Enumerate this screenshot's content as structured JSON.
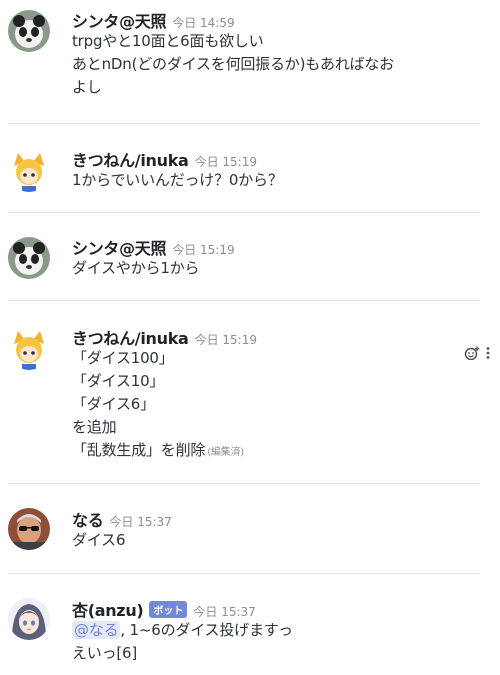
{
  "messages": [
    {
      "author": "シンタ@天照",
      "timestamp": "今日 14:59",
      "avatar": "panda-avatar",
      "lines": [
        "trpgやと10面と6面も欲しい",
        "あとnDn(どのダイスを何回振るか)もあればなお",
        "よし"
      ]
    },
    {
      "author": "きつねん/inuka",
      "timestamp": "今日 15:19",
      "avatar": "fox-girl-avatar",
      "lines": [
        "1からでいいんだっけ？0から？"
      ]
    },
    {
      "author": "シンタ@天照",
      "timestamp": "今日 15:19",
      "avatar": "panda-avatar",
      "lines": [
        "ダイスやから1から"
      ]
    },
    {
      "author": "きつねん/inuka",
      "timestamp": "今日 15:19",
      "avatar": "fox-girl-avatar",
      "lines": [
        "「ダイス100」",
        "「ダイス10」",
        "「ダイス6」",
        "を追加",
        "「乱数生成」を削除"
      ],
      "edited_label": "(編集済)"
    },
    {
      "author": "なる",
      "timestamp": "今日 15:37",
      "avatar": "man-sunglasses-avatar",
      "lines": [
        "ダイス6"
      ]
    },
    {
      "author": "杏(anzu)",
      "timestamp": "今日 15:37",
      "avatar": "anime-girl-avatar",
      "bot_tag": "ボット",
      "mention": "@なる",
      "mention_rest": ", 1~6のダイス投げますっ",
      "lines": [
        "えいっ[6]"
      ]
    }
  ],
  "hover_actions": {
    "emoji_icon": "add-reaction-icon",
    "more_icon": "more-options-icon"
  },
  "colors": {
    "text": "#2e3338",
    "timestamp": "#8a8e94",
    "divider": "#e2e4e7",
    "bot_tag": "#7289da",
    "mention_bg": "#e4e9f9",
    "mention_text": "#6f85d4"
  }
}
